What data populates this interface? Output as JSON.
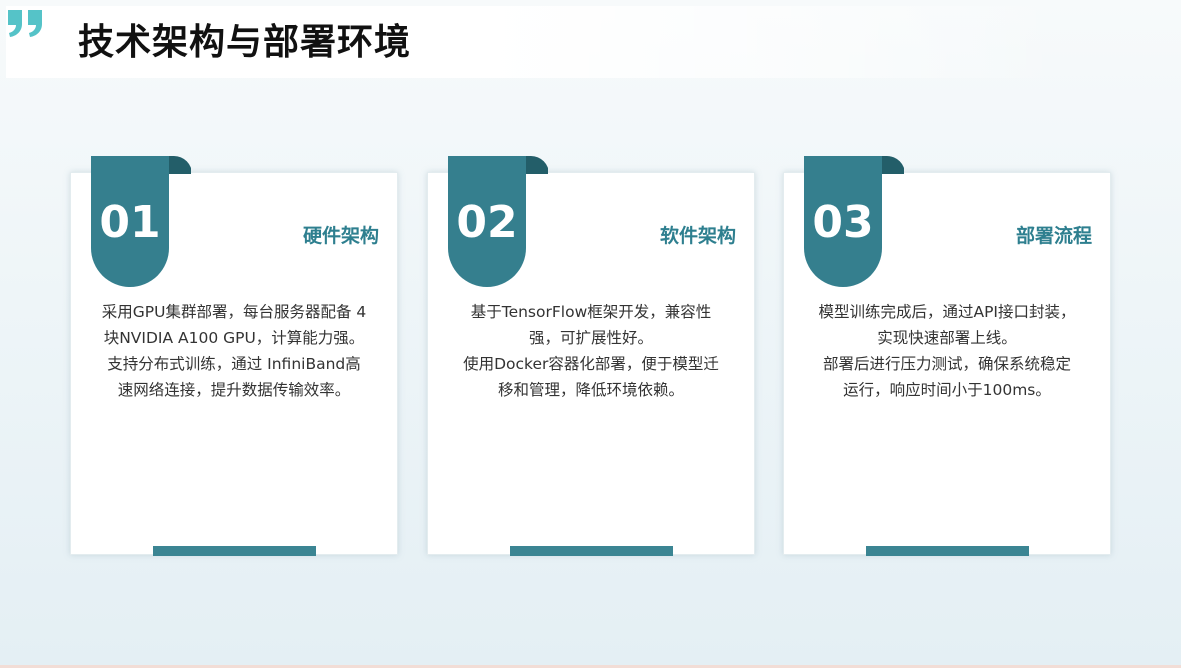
{
  "page": {
    "title": "技术架构与部署环境"
  },
  "colors": {
    "accent": "#2e7f8f",
    "ribbon": "#357f8e",
    "ribbon_fold": "#235e69",
    "quote": "#55c3c8"
  },
  "cards": [
    {
      "number": "01",
      "title": "硬件架构",
      "body": "采用GPU集群部署，每台服务器配备 4\n块NVIDIA A100 GPU，计算能力强。\n  支持分布式训练，通过 InfiniBand高\n速网络连接，提升数据传输效率。"
    },
    {
      "number": "02",
      "title": "软件架构",
      "body": "  基于TensorFlow框架开发，兼容性\n                      强，可扩展性好。\n使用Docker容器化部署，便于模型迁\n                移和管理，降低环境依赖。"
    },
    {
      "number": "03",
      "title": "部署流程",
      "body": "模型训练完成后，通过API接口封装，\n                   实现快速部署上线。\n  部署后进行压力测试，确保系统稳定\n                   运行，响应时间小于100ms。"
    }
  ]
}
